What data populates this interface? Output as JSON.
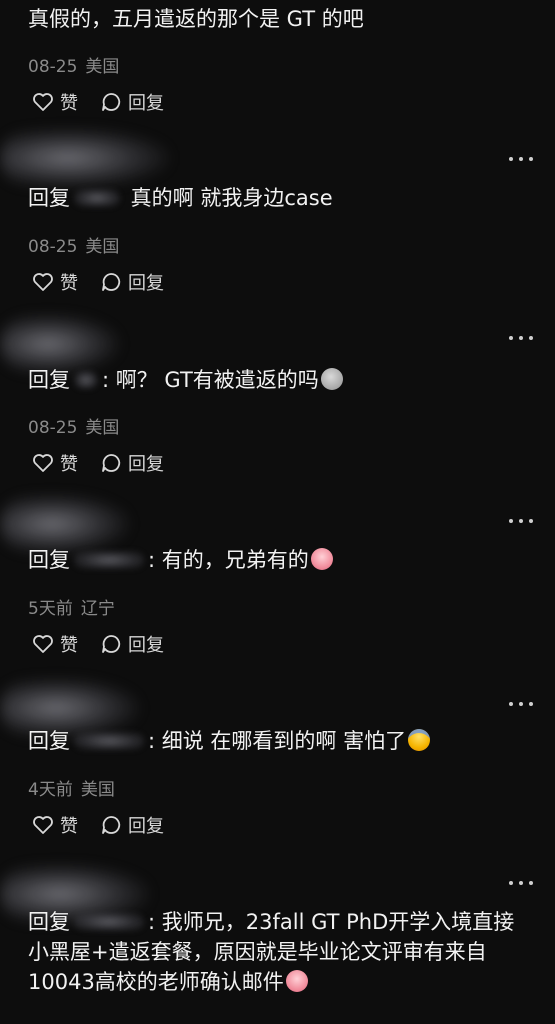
{
  "labels": {
    "reply_prefix": "回复",
    "like": "赞",
    "reply": "回复"
  },
  "comments": [
    {
      "text": "真假的，五月遣返的那个是 GT 的吧",
      "date": "08-25",
      "location": "美国"
    },
    {
      "text": " 真的啊 就我身边case",
      "date": "08-25",
      "location": "美国"
    },
    {
      "text": ": 啊？ GT有被遣返的吗",
      "emoji": "sweat-emoji",
      "date": "08-25",
      "location": "美国"
    },
    {
      "text": ": 有的，兄弟有的",
      "emoji": "crying-emoji",
      "date": "5天前",
      "location": "辽宁"
    },
    {
      "text": ": 细说 在哪看到的啊 害怕了",
      "emoji": "screaming-emoji",
      "date": "4天前",
      "location": "美国"
    },
    {
      "text": ": 我师兄，23fall GT PhD开学入境直接小黑屋+遣返套餐，原因就是毕业论文评审有来自10043高校的老师确认邮件",
      "emoji": "crying-emoji"
    }
  ],
  "colors": {
    "background": "#0d0d0d",
    "text": "#f2f2f2",
    "meta": "#8a8a8a"
  }
}
